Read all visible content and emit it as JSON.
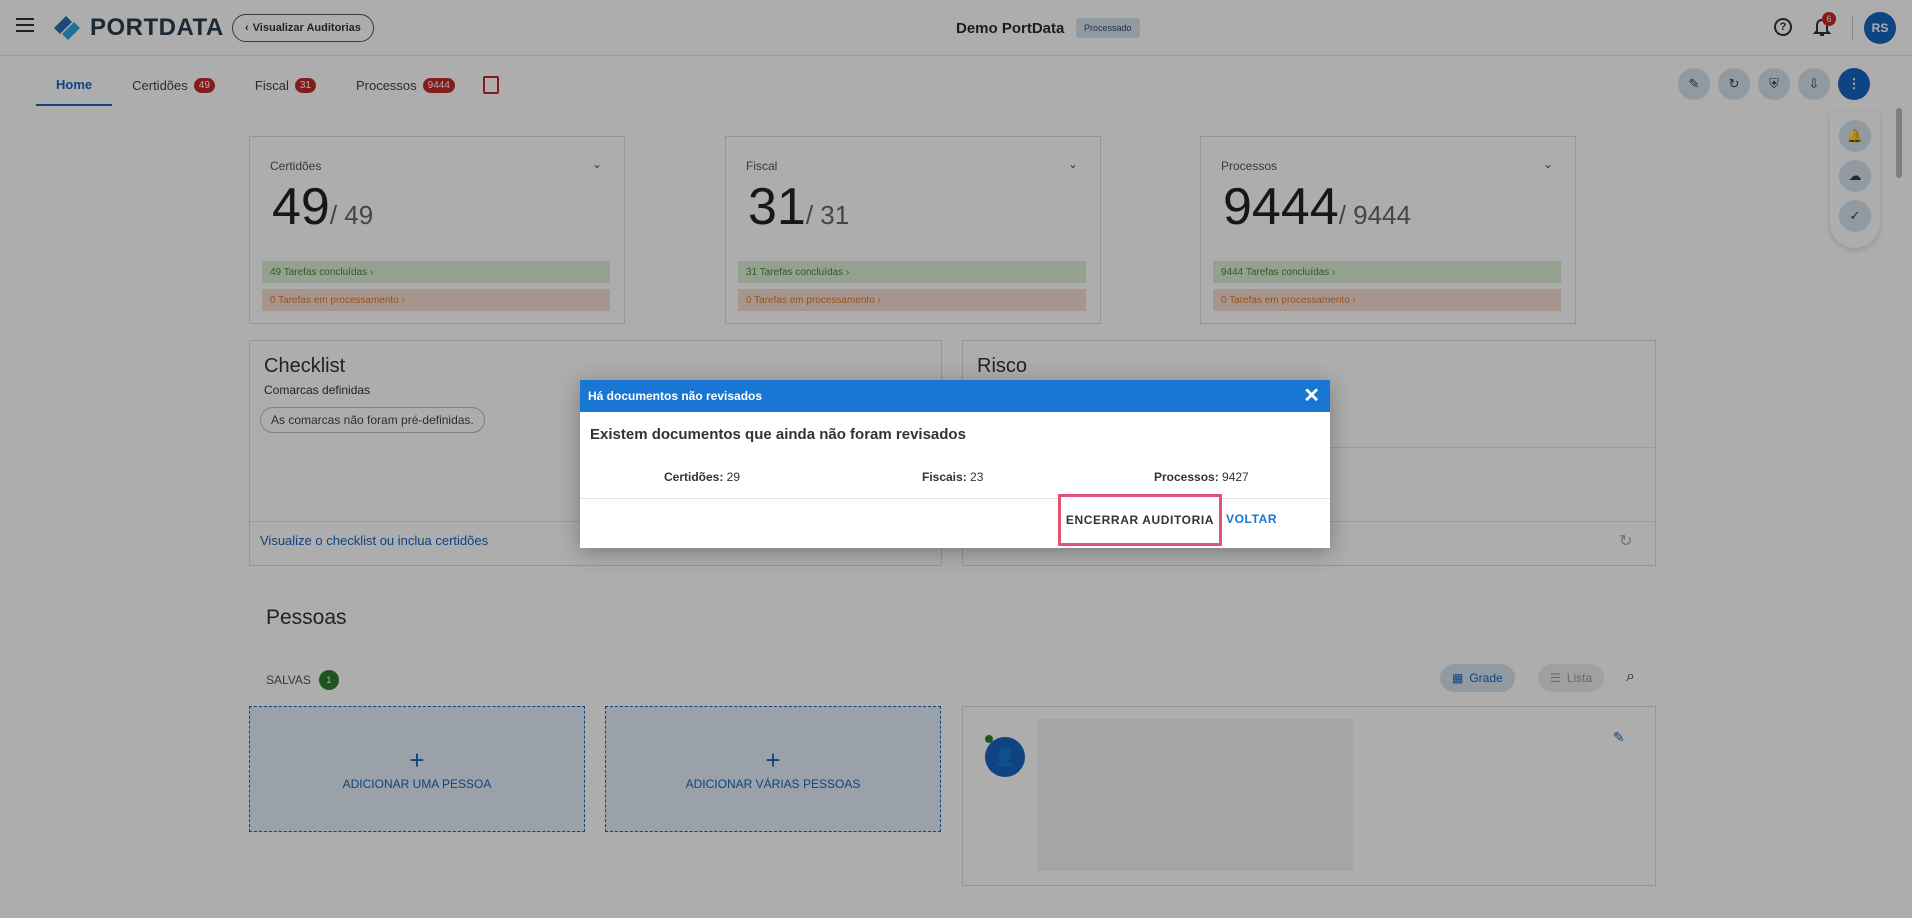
{
  "header": {
    "brand": "PORTDATA",
    "brand_light": "",
    "back_label": "Visualizar Auditorias",
    "title": "Demo PortData",
    "status": "Processado",
    "notifications": "6",
    "user_initials": "RS"
  },
  "tabs": [
    {
      "label": "Home",
      "badge": ""
    },
    {
      "label": "Certidões",
      "badge": "49"
    },
    {
      "label": "Fiscal",
      "badge": "31"
    },
    {
      "label": "Processos",
      "badge": "9444"
    }
  ],
  "kpis": [
    {
      "title": "Certidões",
      "value": "49",
      "total": "/ 49",
      "done": "49 Tarefas concluídas",
      "processing": "0 Tarefas em processamento"
    },
    {
      "title": "Fiscal",
      "value": "31",
      "total": "/ 31",
      "done": "31 Tarefas concluídas",
      "processing": "0 Tarefas em processamento"
    },
    {
      "title": "Processos",
      "value": "9444",
      "total": "/ 9444",
      "done": "9444 Tarefas concluídas",
      "processing": "0 Tarefas em processamento"
    }
  ],
  "checklist": {
    "title": "Checklist",
    "subtitle": "Comarcas definidas",
    "chip": "As comarcas não foram pré-definidas.",
    "link": "Visualize o checklist ou inclua certidões"
  },
  "risco": {
    "title": "Risco"
  },
  "pessoas": {
    "title": "Pessoas",
    "saved_label": "SALVAS",
    "saved_count": "1",
    "add_one": "ADICIONAR UMA PESSOA",
    "add_many": "ADICIONAR VÁRIAS PESSOAS",
    "view_grid": "Grade",
    "view_list": "Lista"
  },
  "modal": {
    "title": "Há documentos não revisados",
    "message": "Existem documentos que ainda não foram revisados",
    "certidoes_label": "Certidões:",
    "certidoes_value": " 29",
    "fiscais_label": "Fiscais:",
    "fiscais_value": " 23",
    "processos_label": "Processos:",
    "processos_value": " 9427",
    "confirm": "ENCERRAR AUDITORIA",
    "back": "VOLTAR"
  },
  "colors": {
    "primary": "#1976d2",
    "danger": "#c62828",
    "success": "#2e7d32",
    "highlight": "#e05573"
  }
}
